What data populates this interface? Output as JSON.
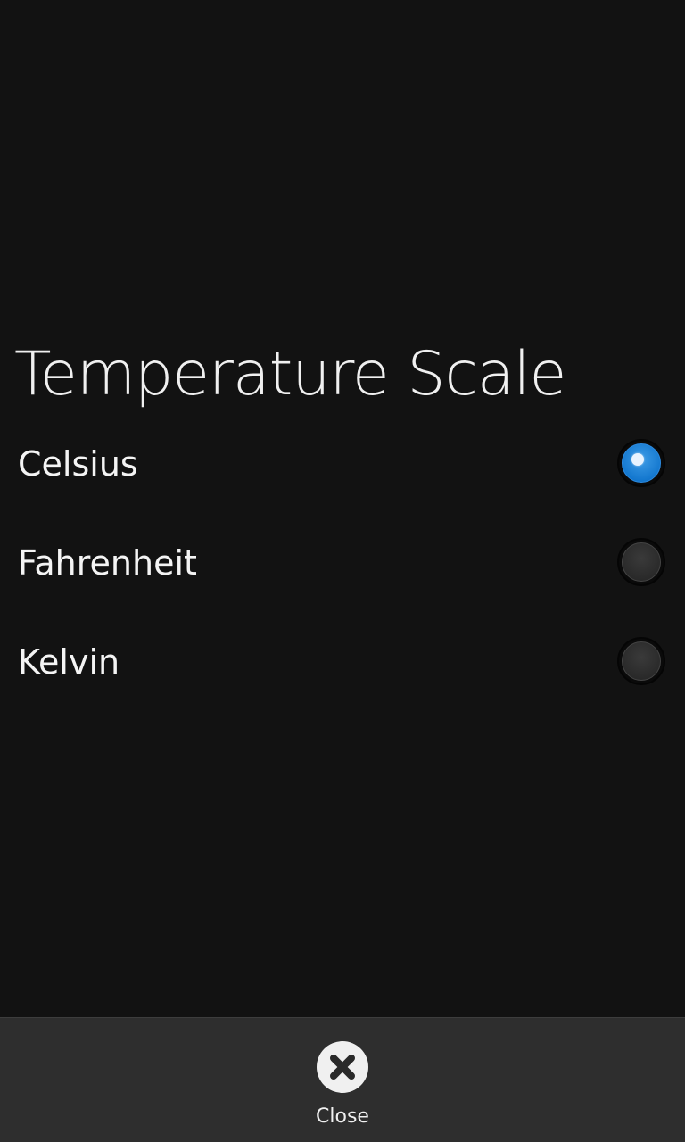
{
  "title": "Temperature Scale",
  "options": [
    {
      "label": "Celsius",
      "selected": true
    },
    {
      "label": "Fahrenheit",
      "selected": false
    },
    {
      "label": "Kelvin",
      "selected": false
    }
  ],
  "action_bar": {
    "close_label": "Close",
    "close_icon": "close-icon"
  },
  "colors": {
    "background": "#121212",
    "action_bar": "#2e2e2e",
    "accent": "#1478cf"
  }
}
